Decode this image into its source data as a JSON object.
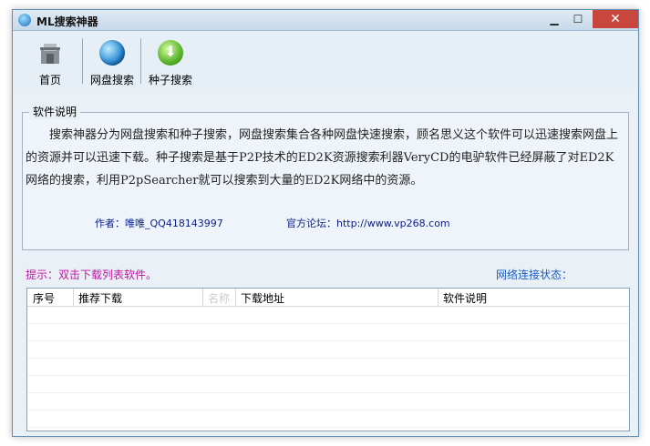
{
  "window": {
    "title": "ML搜索神器"
  },
  "toolbar": {
    "items": [
      {
        "label": "首页",
        "icon": "home-icon"
      },
      {
        "label": "网盘搜索",
        "icon": "globe-icon"
      },
      {
        "label": "种子搜索",
        "icon": "download-arrow-icon"
      }
    ]
  },
  "about": {
    "group_title": "软件说明",
    "description": "　　搜索神器分为网盘搜索和种子搜索，网盘搜索集合各种网盘快速搜索，顾名思义这个软件可以迅速搜索网盘上的资源并可以迅速下载。种子搜索是基于P2P技术的ED2K资源搜索利器VeryCD的电驴软件已经屏蔽了对ED2K网络的搜索，利用P2pSearcher就可以搜索到大量的ED2K网络中的资源。",
    "author_label": "作者：",
    "author_value": "唯唯_QQ418143997",
    "forum_label": "官方论坛：",
    "forum_value": "http://www.vp268.com"
  },
  "status": {
    "tip": "提示：双击下载列表软件。",
    "network_label": "网络连接状态："
  },
  "download_list": {
    "columns": [
      "序号",
      "推荐下载",
      "名称",
      "下载地址",
      "软件说明"
    ]
  },
  "colors": {
    "accent": "#1a5bc8",
    "tip": "#c0179f",
    "close": "#c9463d"
  }
}
